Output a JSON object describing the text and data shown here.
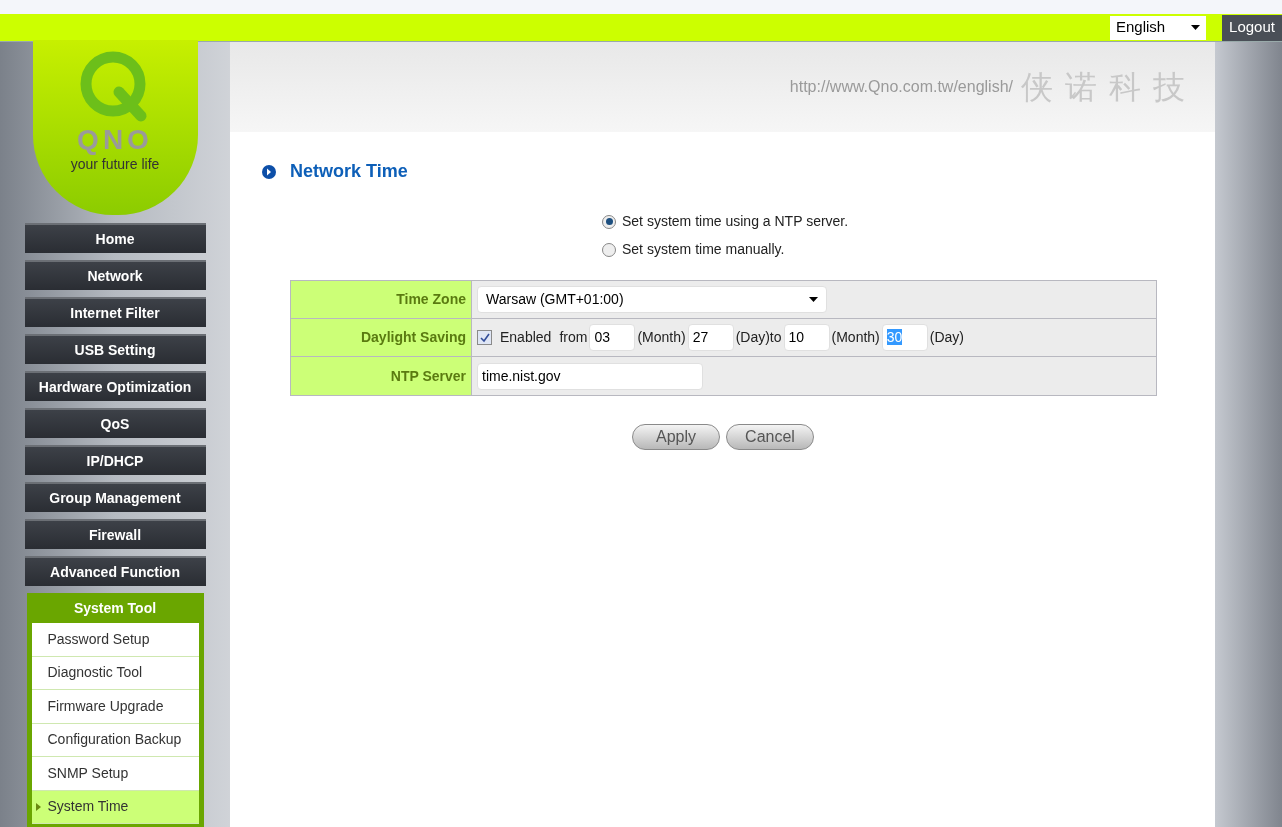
{
  "header": {
    "language": "English",
    "logout": "Logout",
    "url": "http://www.Qno.com.tw/english/",
    "chinese_name": "侠诺科技"
  },
  "logo": {
    "brand": "QNO",
    "tagline": "your future life"
  },
  "nav": [
    {
      "label": "Home",
      "selected": false
    },
    {
      "label": "Network",
      "selected": false
    },
    {
      "label": "Internet Filter",
      "selected": false
    },
    {
      "label": "USB Setting",
      "selected": false
    },
    {
      "label": "Hardware Optimization",
      "selected": false
    },
    {
      "label": "QoS",
      "selected": false
    },
    {
      "label": "IP/DHCP",
      "selected": false
    },
    {
      "label": "Group Management",
      "selected": false
    },
    {
      "label": "Firewall",
      "selected": false
    },
    {
      "label": "Advanced Function",
      "selected": false
    }
  ],
  "section": {
    "title": "System Tool",
    "items": [
      {
        "label": "Password Setup",
        "selected": false
      },
      {
        "label": "Diagnostic Tool",
        "selected": false
      },
      {
        "label": "Firmware Upgrade",
        "selected": false
      },
      {
        "label": "Configuration Backup",
        "selected": false
      },
      {
        "label": "SNMP Setup",
        "selected": false
      },
      {
        "label": "System Time",
        "selected": true
      }
    ]
  },
  "page_title": "Network Time",
  "modes": [
    {
      "label": "Set system time using a NTP server.",
      "selected": true
    },
    {
      "label": "Set system time manually.",
      "selected": false
    }
  ],
  "form": [
    {
      "kind": "select",
      "label": "Time Zone",
      "value": "Warsaw (GMT+01:00)"
    },
    {
      "kind": "daylight",
      "label": "Daylight Saving",
      "checked": true,
      "check_label": "Enabled",
      "parts": [
        {
          "text": "from",
          "value": "03",
          "highlighted": false
        },
        {
          "text": "(Month)",
          "value": "27",
          "highlighted": false
        },
        {
          "text": "(Day)to",
          "value": "10",
          "highlighted": false
        },
        {
          "text": "(Month)",
          "value": "30",
          "highlighted": true
        }
      ],
      "suffix": "(Day)"
    },
    {
      "kind": "text",
      "label": "NTP Server",
      "value": "time.nist.gov"
    }
  ],
  "buttons": [
    "Apply",
    "Cancel"
  ]
}
